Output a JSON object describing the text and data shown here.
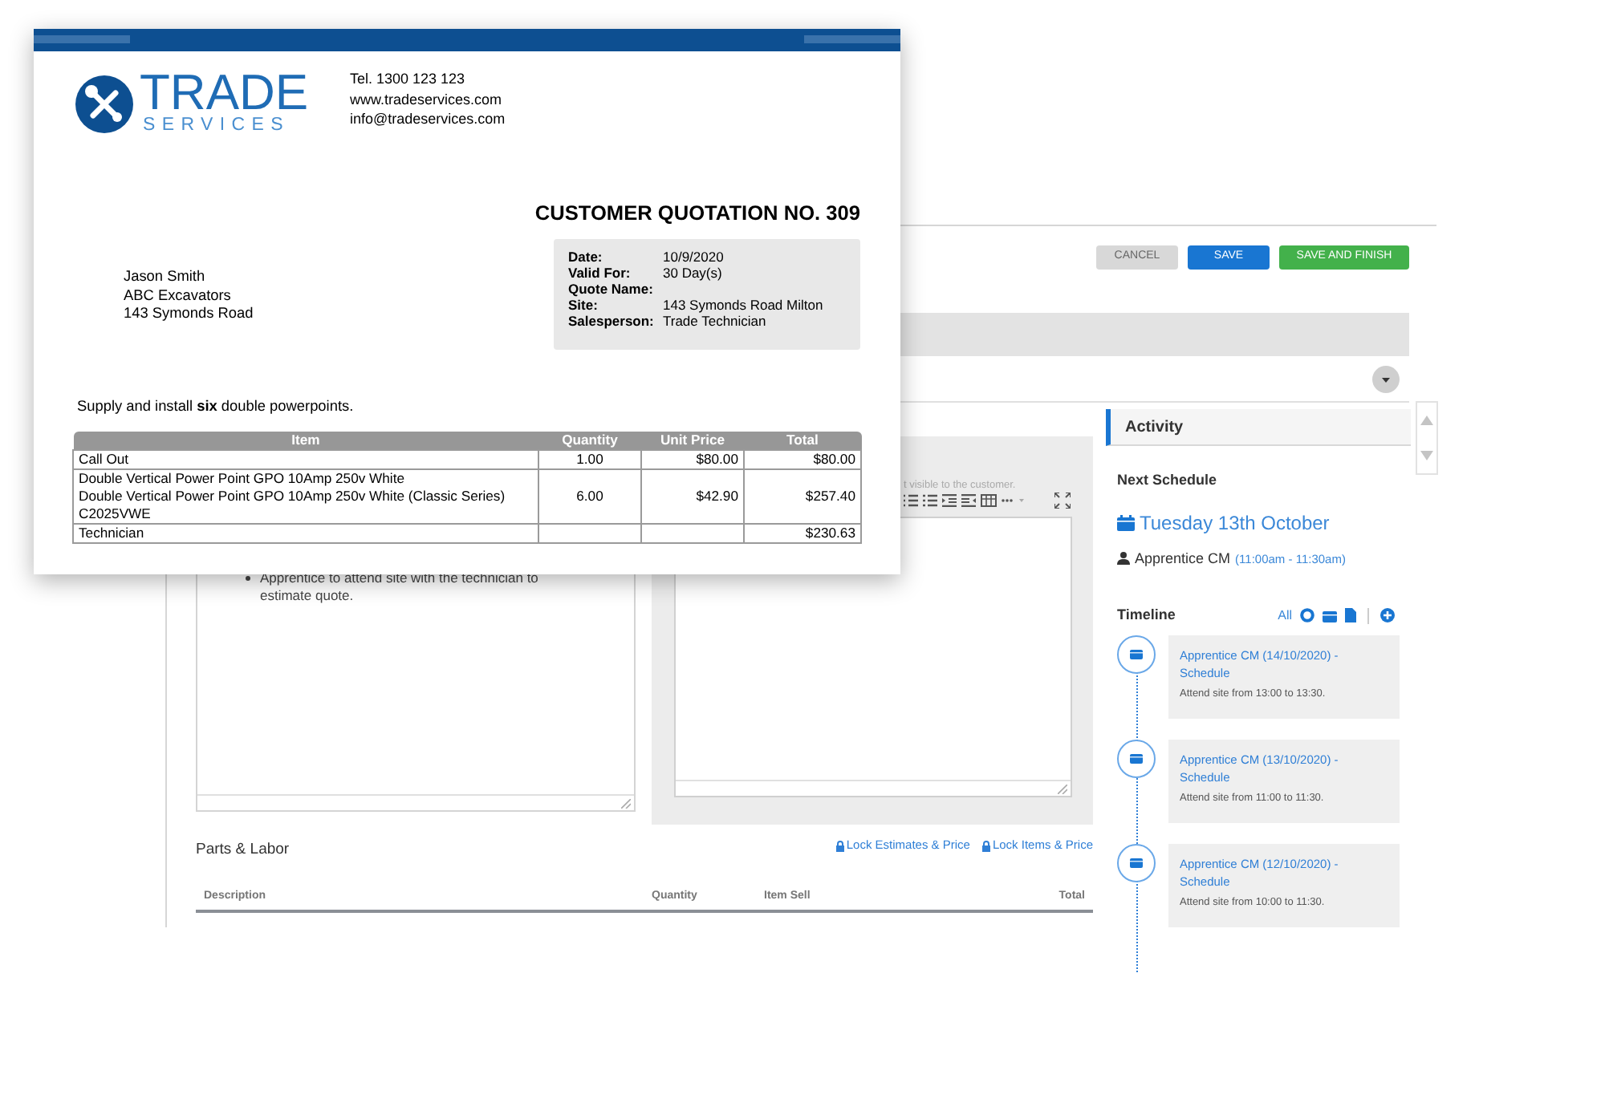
{
  "quotation": {
    "company": {
      "name": "TRADE",
      "tagline": "SERVICES"
    },
    "contact": [
      "Tel. 1300 123 123",
      "www.tradeservices.com",
      "info@tradeservices.com"
    ],
    "title": "CUSTOMER QUOTATION NO. 309",
    "details": [
      {
        "label": "Date:",
        "value": "10/9/2020"
      },
      {
        "label": "Valid For:",
        "value": "30 Day(s)"
      },
      {
        "label": "Quote Name:"
      },
      {
        "label": "Site:",
        "value": "143 Symonds Road Milton"
      },
      {
        "label": "Salesperson:",
        "value": "Trade Technician"
      }
    ],
    "recipient": [
      "Jason Smith",
      "ABC Excavators",
      "143 Symonds Road"
    ],
    "description": "Supply and install **six** double powerpoints.",
    "table": {
      "columns": [
        "Item",
        "Quantity",
        "Unit Price",
        "Total"
      ],
      "rows": [
        {
          "item": [
            "Call Out"
          ],
          "quantity": "1.00",
          "unit_price": "$80.00",
          "total": "$80.00"
        },
        {
          "item": [
            "Double Vertical Power Point GPO 10Amp 250v White",
            "Double Vertical Power Point GPO 10Amp 250v White (Classic Series) C2025VWE"
          ],
          "quantity": "6.00",
          "unit_price": "$42.90",
          "total": "$257.40"
        },
        {
          "item": [
            "Technician"
          ],
          "total": "$230.63"
        }
      ]
    }
  },
  "app": {
    "buttons": [
      {
        "label": "CANCEL",
        "kind": "secondary"
      },
      {
        "label": "SAVE",
        "kind": "primary"
      },
      {
        "label": "SAVE AND FINISH",
        "kind": "success"
      }
    ],
    "notes": [
      "Apprentice to attend site with the technician to estimate quote."
    ],
    "internal_hint": "t visible to the customer.",
    "parts": {
      "title": "Parts & Labor",
      "links": [
        "Lock Estimates & Price",
        "Lock Items & Price"
      ],
      "columns": [
        "Description",
        "Quantity",
        "Item Sell",
        "Total"
      ]
    },
    "activity": {
      "title": "Activity",
      "next_schedule": {
        "heading": "Next Schedule",
        "date": "Tuesday 13th October",
        "person": "Apprentice CM",
        "time": "(11:00am - 11:30am)"
      },
      "timeline": {
        "heading": "Timeline",
        "filter": "All",
        "entries": [
          {
            "title": "Apprentice CM (14/10/2020) - Schedule",
            "note": "Attend site from 13:00 to 13:30."
          },
          {
            "title": "Apprentice CM (13/10/2020) - Schedule",
            "note": "Attend site from 11:00 to 11:30."
          },
          {
            "title": "Apprentice CM (12/10/2020) - Schedule",
            "note": "Attend site from 10:00 to 11:30."
          }
        ]
      }
    }
  }
}
